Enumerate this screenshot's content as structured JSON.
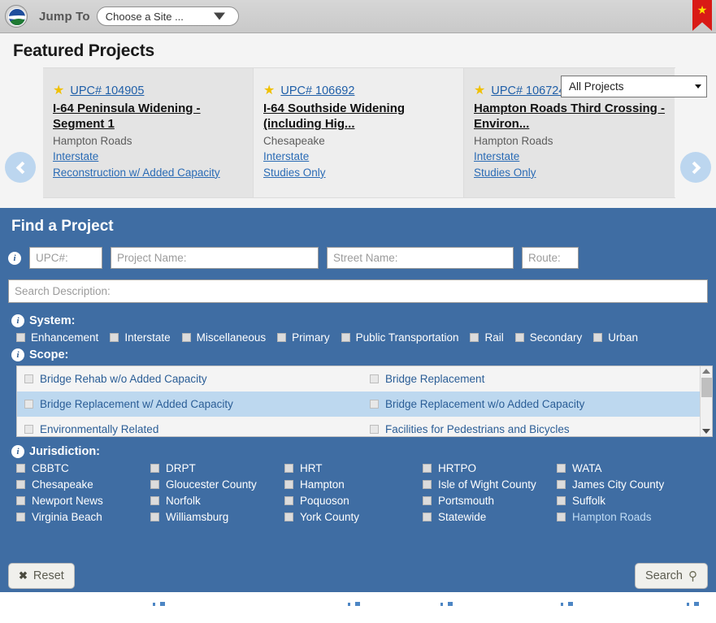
{
  "topbar": {
    "logo_name": "vdot-seal-logo",
    "jump_label": "Jump To",
    "site_select_value": "Choose a Site ...",
    "bookmark_star": "★"
  },
  "featured": {
    "heading": "Featured Projects",
    "filter_value": "All Projects",
    "prev_label": "‹",
    "next_label": "›",
    "cards": [
      {
        "star": "★",
        "upc": "UPC# 104905",
        "title": "I-64 Peninsula Widening - Segment 1",
        "location": "Hampton Roads",
        "system": "Interstate",
        "scope": "Reconstruction w/ Added Capacity"
      },
      {
        "star": "★",
        "upc": "UPC# 106692",
        "title": "I-64 Southside Widening (including Hig...",
        "location": "Chesapeake",
        "system": "Interstate",
        "scope": "Studies Only"
      },
      {
        "star": "★",
        "upc": "UPC# 106724",
        "title": "Hampton Roads Third Crossing - Environ...",
        "location": "Hampton Roads",
        "system": "Interstate",
        "scope": "Studies Only"
      }
    ]
  },
  "finder": {
    "heading": "Find a Project",
    "info_glyph": "i",
    "fields": {
      "upc_placeholder": "UPC#:",
      "project_name_placeholder": "Project Name:",
      "street_name_placeholder": "Street Name:",
      "route_placeholder": "Route:",
      "description_placeholder": "Search Description:"
    },
    "system": {
      "label": "System:",
      "options": [
        "Enhancement",
        "Interstate",
        "Miscellaneous",
        "Primary",
        "Public Transportation",
        "Rail",
        "Secondary",
        "Urban"
      ]
    },
    "scope": {
      "label": "Scope:",
      "rows": [
        {
          "left": "Bridge Rehab w/o Added Capacity",
          "right": "Bridge Replacement"
        },
        {
          "left": "Bridge Replacement w/ Added Capacity",
          "right": "Bridge Replacement w/o Added Capacity"
        },
        {
          "left": "Environmentally Related",
          "right": "Facilities for Pedestrians and Bicycles"
        }
      ]
    },
    "jurisdiction": {
      "label": "Jurisdiction:",
      "options": [
        "CBBTC",
        "DRPT",
        "HRT",
        "HRTPO",
        "WATA",
        "Chesapeake",
        "Gloucester County",
        "Hampton",
        "Isle of Wight County",
        "James City County",
        "Newport News",
        "Norfolk",
        "Poquoson",
        "Portsmouth",
        "Suffolk",
        "Virginia Beach",
        "Williamsburg",
        "York County",
        "Statewide",
        "Hampton Roads"
      ]
    },
    "buttons": {
      "reset_label": "Reset",
      "reset_glyph": "✖",
      "search_label": "Search",
      "search_glyph": "⚲"
    }
  },
  "colors": {
    "panel_blue": "#3f6da3",
    "link_blue": "#2a6bb5",
    "highlight_row": "#bdd8ef",
    "ribbon_red": "#d91a16",
    "star_yellow": "#f0c000"
  }
}
